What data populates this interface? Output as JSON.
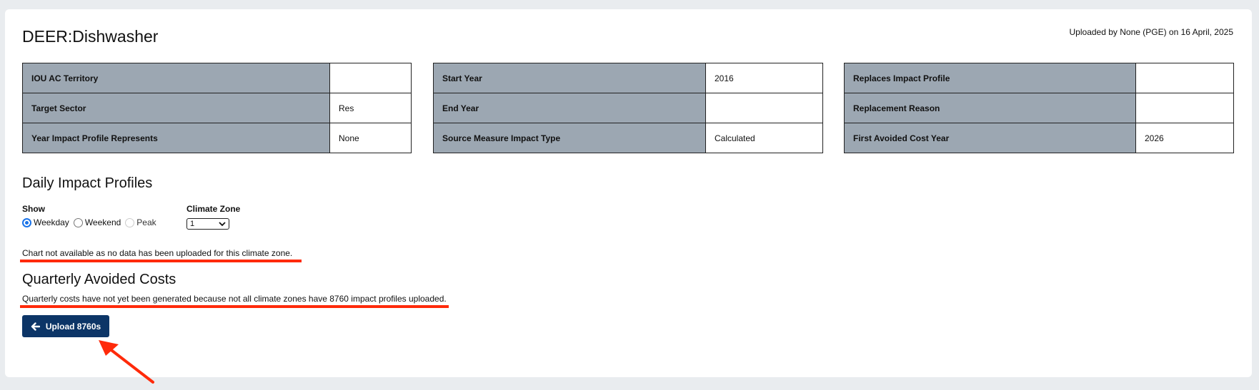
{
  "header": {
    "title": "DEER:Dishwasher",
    "uploaded": "Uploaded by None (PGE) on 16 April, 2025"
  },
  "table1": [
    {
      "k": "IOU AC Territory",
      "v": ""
    },
    {
      "k": "Target Sector",
      "v": "Res"
    },
    {
      "k": "Year Impact Profile Represents",
      "v": "None"
    }
  ],
  "table2": [
    {
      "k": "Start Year",
      "v": "2016"
    },
    {
      "k": "End Year",
      "v": ""
    },
    {
      "k": "Source Measure Impact Type",
      "v": "Calculated"
    }
  ],
  "table3": [
    {
      "k": "Replaces Impact Profile",
      "v": ""
    },
    {
      "k": "Replacement Reason",
      "v": ""
    },
    {
      "k": "First Avoided Cost Year",
      "v": "2026"
    }
  ],
  "daily": {
    "title": "Daily Impact Profiles",
    "show_label": "Show",
    "options": [
      "Weekday",
      "Weekend",
      "Peak"
    ],
    "climate_label": "Climate Zone",
    "climate_value": "1",
    "message": "Chart not available as no data has been uploaded for this climate zone."
  },
  "quarterly": {
    "title": "Quarterly Avoided Costs",
    "message": "Quarterly costs have not yet been generated because not all climate zones have 8760 impact profiles uploaded."
  },
  "button": {
    "label": "Upload 8760s"
  },
  "colors": {
    "header_cell": "#9ca7b2",
    "button": "#0c3567",
    "annotation": "#ff2a0a"
  }
}
